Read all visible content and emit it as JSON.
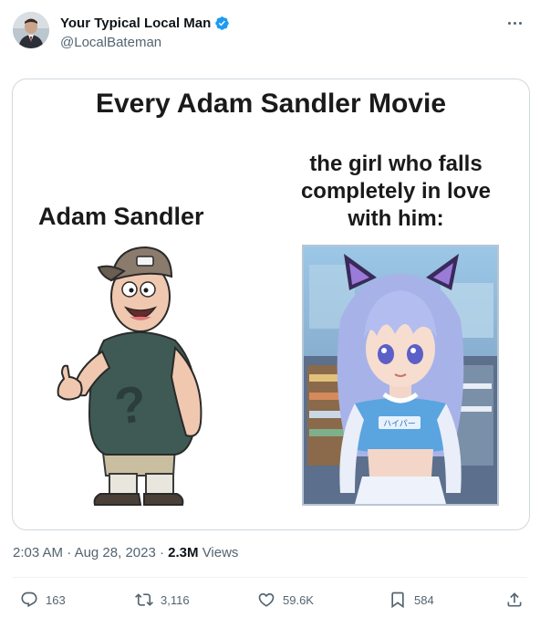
{
  "author": {
    "display_name": "Your Typical Local Man",
    "handle": "@LocalBateman"
  },
  "media": {
    "title": "Every Adam Sandler Movie",
    "left_caption": "Adam Sandler",
    "right_caption_lines": [
      "the girl who falls",
      "completely in love",
      "with him:"
    ],
    "shirt_text": "ハイパー"
  },
  "meta": {
    "time": "2:03 AM",
    "separator": "·",
    "date": "Aug 28, 2023",
    "views_count": "2.3M",
    "views_label": "Views"
  },
  "actions": {
    "replies": "163",
    "reposts": "3,116",
    "likes": "59.6K",
    "bookmarks": "584"
  },
  "colors": {
    "verified": "#1d9bf0",
    "secondary_text": "#536471",
    "border": "#cfd9de"
  }
}
